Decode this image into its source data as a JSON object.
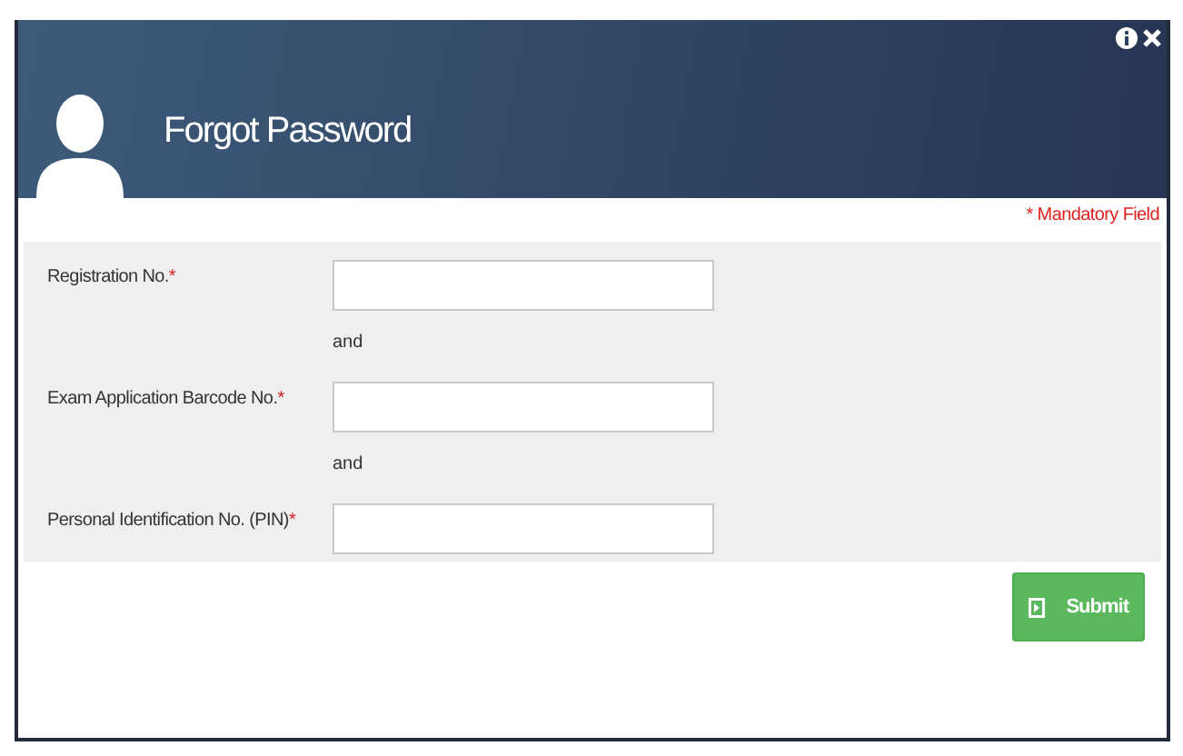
{
  "dialog": {
    "title": "Forgot Password",
    "mandatory_note": "* Mandatory Field"
  },
  "fields": [
    {
      "label": "Registration No.",
      "mark": "*",
      "joiner": "and"
    },
    {
      "label": "Exam Application Barcode No.",
      "mark": "*",
      "joiner": "and"
    },
    {
      "label": "Personal Identification No. (PIN)",
      "mark": "*"
    }
  ],
  "buttons": [
    {
      "label": "Submit"
    }
  ]
}
